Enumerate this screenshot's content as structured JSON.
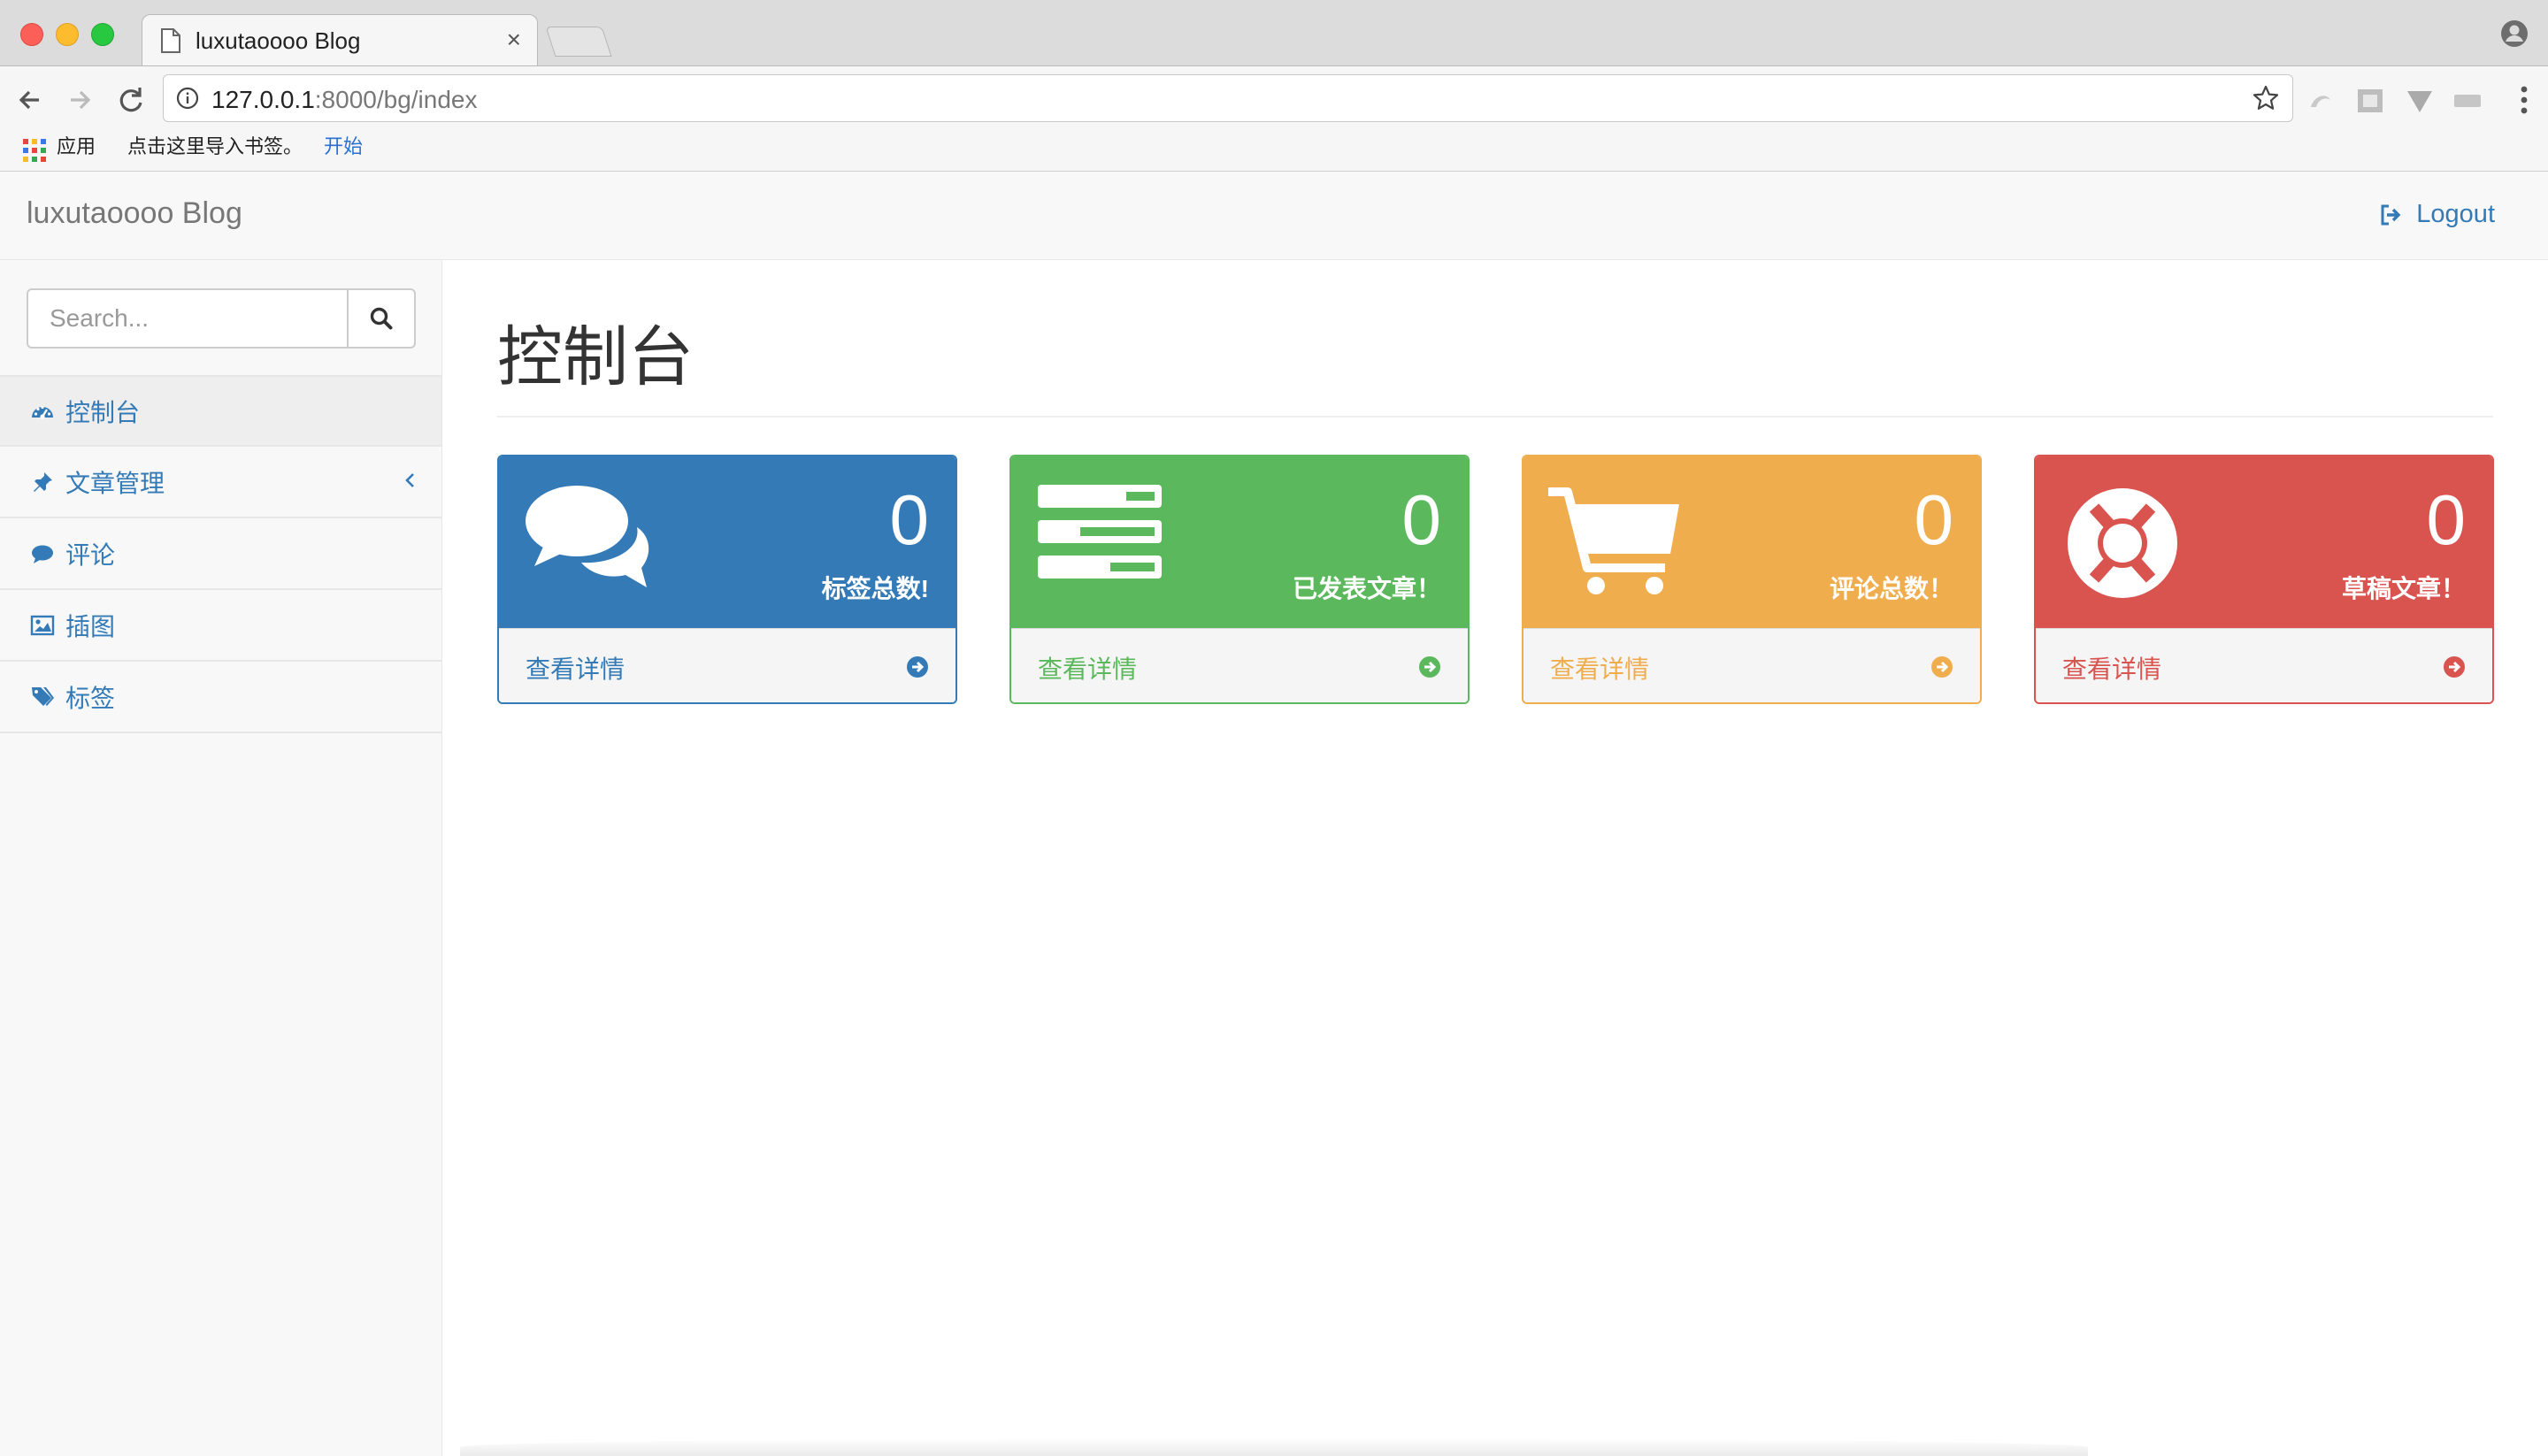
{
  "browser": {
    "tab_title": "luxutaoooo Blog",
    "tab_close": "×",
    "url_host": "127.0.0.1",
    "url_rest": ":8000/bg/index",
    "bookmarks": {
      "apps_label": "应用",
      "import_label": "点击这里导入书签。",
      "start_label": "开始"
    }
  },
  "navbar": {
    "brand": "luxutaoooo Blog",
    "logout_label": "Logout"
  },
  "sidebar": {
    "search_placeholder": "Search...",
    "items": [
      {
        "label": "控制台",
        "icon": "dashboard-icon",
        "active": true
      },
      {
        "label": "文章管理",
        "icon": "pin-icon",
        "has_caret": true
      },
      {
        "label": "评论",
        "icon": "comment-icon"
      },
      {
        "label": "插图",
        "icon": "image-icon"
      },
      {
        "label": "标签",
        "icon": "tags-icon"
      }
    ]
  },
  "main": {
    "title": "控制台",
    "panels": [
      {
        "count": "0",
        "caption": "标签总数!",
        "detail": "查看详情",
        "icon": "comments-icon",
        "color": "#337ab7"
      },
      {
        "count": "0",
        "caption": "已发表文章！",
        "detail": "查看详情",
        "icon": "tasks-icon",
        "color": "#5cb85c"
      },
      {
        "count": "0",
        "caption": "评论总数！",
        "detail": "查看详情",
        "icon": "shopping-cart-icon",
        "color": "#f0ad4e"
      },
      {
        "count": "0",
        "caption": "草稿文章！",
        "detail": "查看详情",
        "icon": "life-ring-icon",
        "color": "#d9534f"
      }
    ]
  }
}
